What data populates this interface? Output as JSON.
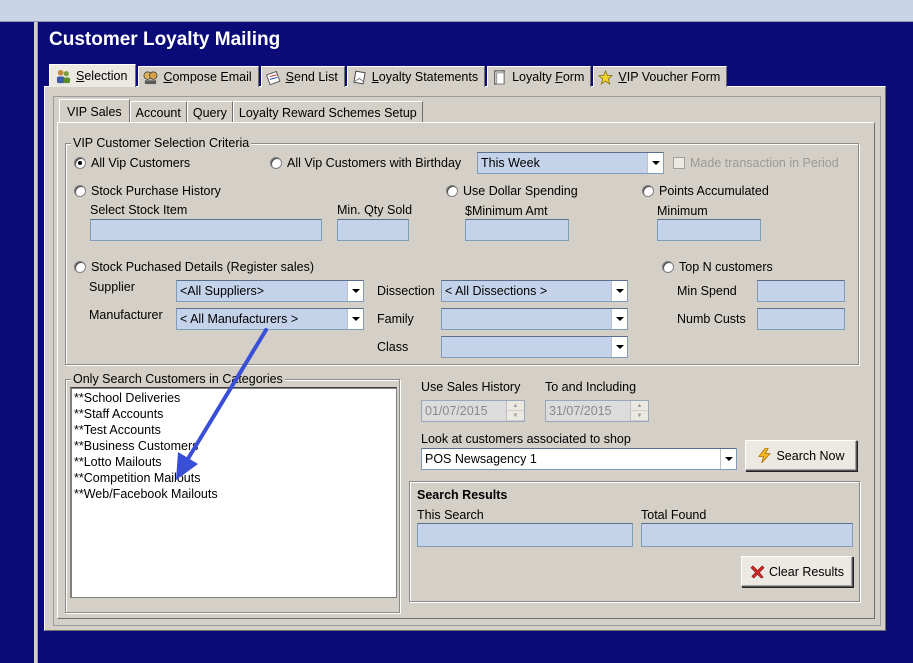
{
  "app": {
    "title": "Customer Loyalty Mailing"
  },
  "tabs": [
    {
      "label": "Selection",
      "icon": "people-icon",
      "accel": "S"
    },
    {
      "label": "Compose Email",
      "icon": "email-people-icon",
      "accel": "C"
    },
    {
      "label": "Send List",
      "icon": "send-list-icon",
      "accel": "S"
    },
    {
      "label": "Loyalty Statements",
      "icon": "statement-icon",
      "accel": "L"
    },
    {
      "label": "Loyalty Form",
      "icon": "form-icon",
      "accel": "F"
    },
    {
      "label": "VIP Voucher Form",
      "icon": "star-icon",
      "accel": "V"
    }
  ],
  "subtabs": [
    "VIP Sales",
    "Account",
    "Query",
    "Loyalty Reward Schemes Setup"
  ],
  "criteria": {
    "legend": "VIP Customer Selection Criteria",
    "all_vip": "All Vip Customers",
    "all_vip_birthday": "All Vip Customers with Birthday",
    "birthday_period": "This Week",
    "made_transaction": "Made transaction in Period",
    "stock_purchase_history": "Stock Purchase History",
    "select_stock_item": "Select Stock Item",
    "min_qty_sold": "Min. Qty Sold",
    "use_dollar_spending": "Use Dollar Spending",
    "minimum_amt": "$Minimum Amt",
    "points_accumulated": "Points Accumulated",
    "minimum": "Minimum",
    "stock_purchased_details": "Stock Puchased Details (Register sales)",
    "supplier_label": "Supplier",
    "supplier_value": "<All Suppliers>",
    "manufacturer_label": "Manufacturer",
    "manufacturer_value": "< All Manufacturers >",
    "dissection_label": "Dissection",
    "dissection_value": "< All Dissections >",
    "family_label": "Family",
    "family_value": "",
    "class_label": "Class",
    "class_value": "",
    "top_n": "Top N customers",
    "min_spend": "Min Spend",
    "numb_custs": "Numb Custs"
  },
  "categories": {
    "legend": "Only Search Customers in Categories",
    "items": [
      "**School Deliveries",
      "**Staff Accounts",
      "**Test Accounts",
      "**Business Customers",
      "**Lotto Mailouts",
      "**Competition Mailouts",
      "**Web/Facebook Mailouts"
    ]
  },
  "history": {
    "use_sales_history": "Use Sales History",
    "to_and_including": "To and Including",
    "from_date": "01/07/2015",
    "to_date": "31/07/2015",
    "shop_label": "Look at customers associated to shop",
    "shop_value": "POS Newsagency 1",
    "search_now": "Search Now"
  },
  "results": {
    "title": "Search Results",
    "this_search": "This Search",
    "total_found": "Total Found",
    "clear_results": "Clear Results"
  },
  "colors": {
    "background": "#0a0a78",
    "field": "#c5d3ea",
    "panel": "#d4d0c8",
    "annotation_arrow": "#3a4fd8"
  }
}
